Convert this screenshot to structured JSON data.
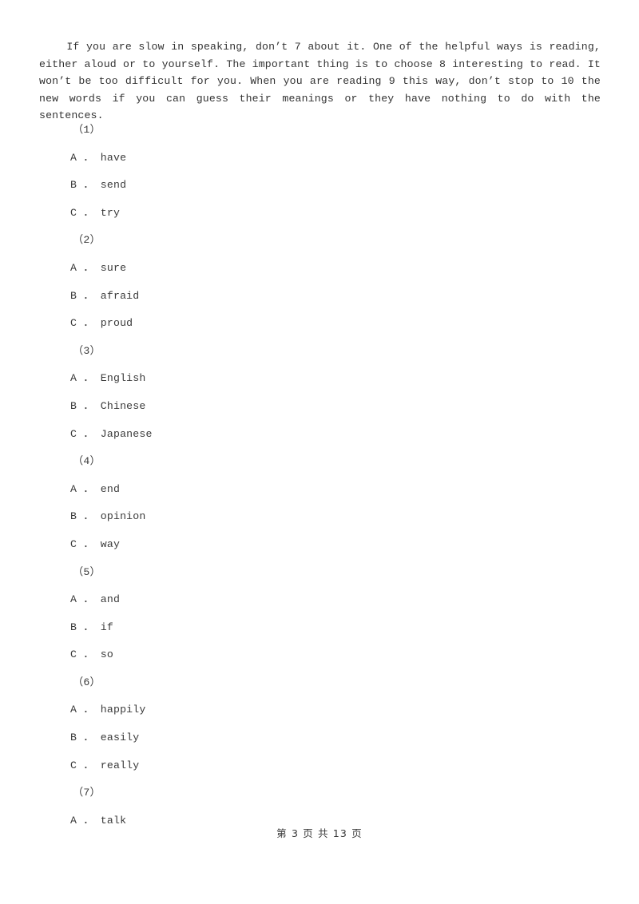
{
  "document": {
    "passage": "If you are slow in speaking, don’t 7 about it. One of the helpful ways is reading, either aloud or to yourself. The important thing is to choose 8 interesting to read. It won’t be too difficult for you. When you are reading 9 this way, don’t stop to 10 the new words if you can guess their meanings or they have nothing to do with the sentences.",
    "questions": [
      {
        "number": "（1）",
        "options": [
          "A ． have",
          "B ． send",
          "C ． try"
        ]
      },
      {
        "number": "（2）",
        "options": [
          "A ． sure",
          "B ． afraid",
          "C ． proud"
        ]
      },
      {
        "number": "（3）",
        "options": [
          "A ． English",
          "B ． Chinese",
          "C ． Japanese"
        ]
      },
      {
        "number": "（4）",
        "options": [
          "A ． end",
          "B ． opinion",
          "C ． way"
        ]
      },
      {
        "number": "（5）",
        "options": [
          "A ． and",
          "B ． if",
          "C ． so"
        ]
      },
      {
        "number": "（6）",
        "options": [
          "A ． happily",
          "B ． easily",
          "C ． really"
        ]
      },
      {
        "number": "（7）",
        "options": [
          "A ． talk"
        ]
      }
    ],
    "footer": "第 3 页 共 13 页"
  }
}
